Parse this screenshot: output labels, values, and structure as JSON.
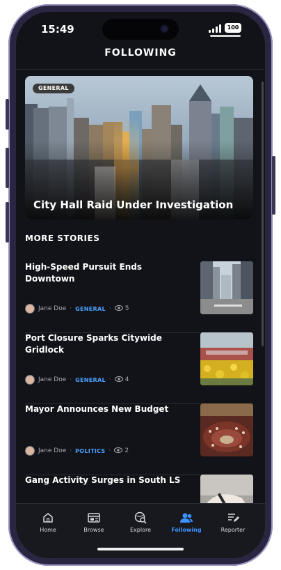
{
  "status": {
    "time": "15:49",
    "battery": "100"
  },
  "header": {
    "title": "FOLLOWING"
  },
  "hero": {
    "badge": "GENERAL",
    "title": "City Hall Raid Under Investigation"
  },
  "section": {
    "title": "MORE STORIES"
  },
  "stories": [
    {
      "title": "High-Speed Pursuit Ends Downtown",
      "author": "Jane Doe",
      "category": "GENERAL",
      "views": "5"
    },
    {
      "title": "Port Closure Sparks Citywide Gridlock",
      "author": "Jane Doe",
      "category": "GENERAL",
      "views": "4"
    },
    {
      "title": "Mayor Announces New Budget",
      "author": "Jane Doe",
      "category": "POLITICS",
      "views": "2"
    },
    {
      "title": "Gang Activity Surges in South LS",
      "author": "",
      "category": "",
      "views": ""
    }
  ],
  "tabs": [
    {
      "label": "Home",
      "icon": "home-icon"
    },
    {
      "label": "Browse",
      "icon": "browse-icon"
    },
    {
      "label": "Explore",
      "icon": "explore-icon"
    },
    {
      "label": "Following",
      "icon": "following-icon"
    },
    {
      "label": "Reporter",
      "icon": "reporter-icon"
    }
  ],
  "colors": {
    "accent": "#3c93ff",
    "background": "#121318",
    "category": "#4aa0ff"
  }
}
